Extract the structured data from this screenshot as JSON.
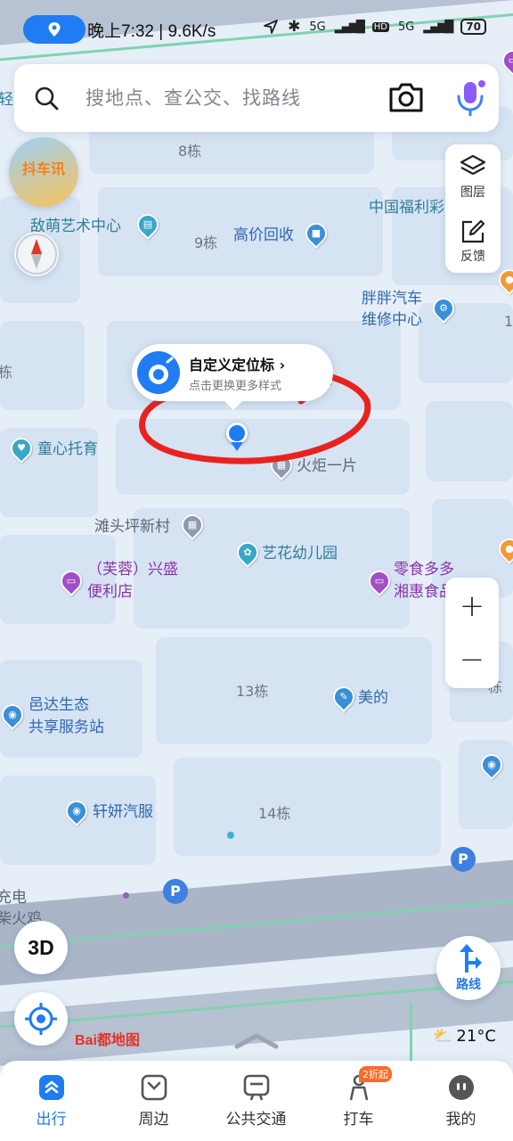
{
  "status_bar": {
    "time_speed": "晚上7:32 | 9.6K/s",
    "net_5g_a": "5G",
    "net_hd": "HD",
    "net_5g_b": "5G",
    "battery": "70"
  },
  "search": {
    "placeholder": "搜地点、查公交、找路线"
  },
  "tools": {
    "layers_label": "图层",
    "feedback_label": "反馈",
    "zoom_in": "+",
    "zoom_out": "−",
    "three_d": "3D",
    "route_label": "路线"
  },
  "promo": {
    "text": "抖车讯"
  },
  "locate_bubble": {
    "title": "自定义定位标 ›",
    "subtitle": "点击更换更多样式"
  },
  "map": {
    "buildings": [
      "8栋",
      "9栋",
      "13栋",
      "14栋",
      "栋",
      "1",
      "栋"
    ],
    "pois": [
      {
        "name": "敌萌艺术中心",
        "icon": "book-icon"
      },
      {
        "name": "高价回收",
        "icon": "shop-icon"
      },
      {
        "name": "中国福利彩",
        "icon": "lottery-icon"
      },
      {
        "name": "胖胖汽车",
        "icon": "car-repair-icon"
      },
      {
        "name": "维修中心",
        "icon": "car-repair-icon"
      },
      {
        "name": "童心托育",
        "icon": "childcare-icon"
      },
      {
        "name": "火炬一片",
        "icon": "building-icon"
      },
      {
        "name": "滩头坪新村",
        "icon": "building-icon"
      },
      {
        "name": "艺花幼儿园",
        "icon": "school-icon"
      },
      {
        "name": "（芙蓉）兴盛",
        "icon": "store-icon"
      },
      {
        "name": "便利店",
        "icon": "store-icon"
      },
      {
        "name": "零食多多",
        "icon": "store-icon"
      },
      {
        "name": "湘惠食品店",
        "icon": "store-icon"
      },
      {
        "name": "美的",
        "icon": "wrench-icon"
      },
      {
        "name": "邑达生态",
        "icon": "car-service-icon"
      },
      {
        "name": "共享服务站",
        "icon": "car-service-icon"
      },
      {
        "name": "轩妍汽服",
        "icon": "car-service-icon"
      },
      {
        "name": "轻",
        "icon": ""
      },
      {
        "name": "充电",
        "icon": ""
      },
      {
        "name": "柴火鸡",
        "icon": ""
      }
    ],
    "parking": "P",
    "logo": "Bai都地图"
  },
  "weather": {
    "temp": "21°C"
  },
  "bottom_nav": {
    "items": [
      {
        "label": "出行",
        "active": true
      },
      {
        "label": "周边",
        "active": false
      },
      {
        "label": "公共交通",
        "active": false
      },
      {
        "label": "打车",
        "active": false,
        "badge": "2折起"
      },
      {
        "label": "我的",
        "active": false
      }
    ]
  },
  "colors": {
    "accent": "#1f7cf3",
    "annotation_red": "#e8231f",
    "poi_blue": "#2e69b3",
    "poi_purple": "#8a35a8"
  }
}
